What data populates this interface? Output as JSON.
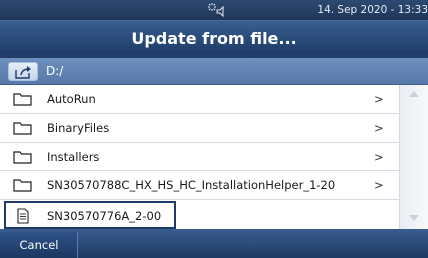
{
  "status": {
    "date_time": "14. Sep 2020 - 13:33",
    "icon": "sun-speaker-icon"
  },
  "title": "Update from file...",
  "path": {
    "label": "D:/",
    "up_icon": "folder-up-icon"
  },
  "files": [
    {
      "name": "AutoRun",
      "type": "folder",
      "chevron": ">"
    },
    {
      "name": "BinaryFiles",
      "type": "folder",
      "chevron": ">"
    },
    {
      "name": "Installers",
      "type": "folder",
      "chevron": ">"
    },
    {
      "name": "SN30570788C_HX_HS_HC_InstallationHelper_1-20",
      "type": "folder",
      "chevron": ">"
    },
    {
      "name": "SN30570776A_2-00",
      "type": "file",
      "selected": true
    }
  ],
  "footer": {
    "cancel_label": "Cancel"
  },
  "colors": {
    "header_dark": "#1f3c68",
    "path_bar": "#5f80b0",
    "selection_border": "#1f3c68"
  }
}
